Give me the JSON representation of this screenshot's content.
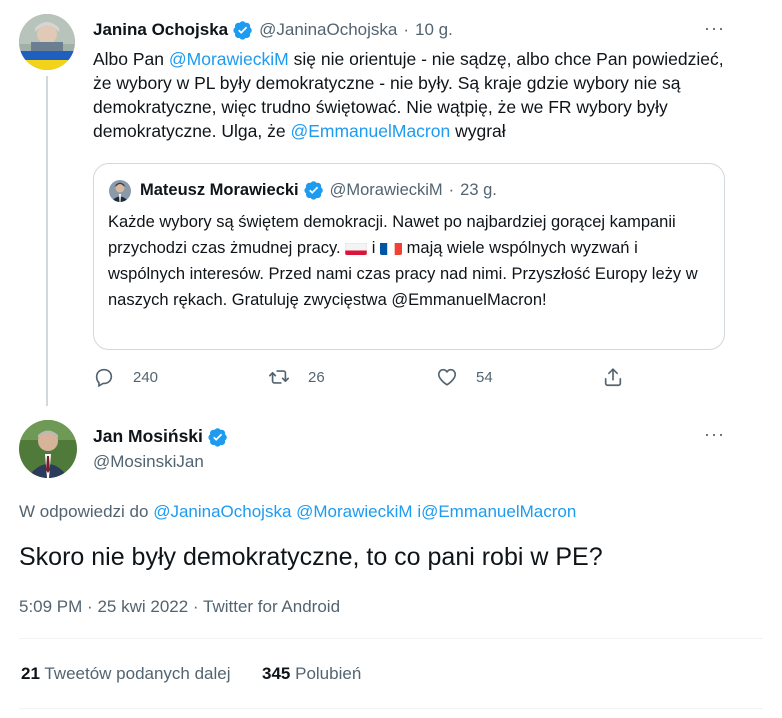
{
  "parent_tweet": {
    "author_name": "Janina Ochojska",
    "author_handle": "@JaninaOchojska",
    "time_separator": "·",
    "time": "10 g.",
    "text_parts": [
      "Albo Pan ",
      "@MorawieckiM",
      "  się nie orientuje - nie sądzę, albo chce Pan powiedzieć, że wybory w PL były demokratyczne - nie były. Są kraje gdzie wybory nie są demokratyczne, więc trudno świętować. Nie wątpię, że we FR wybory były demokratyczne. Ulga, że ",
      "@EmmanuelMacron",
      " wygrał"
    ],
    "more_label": "···",
    "actions": {
      "reply_count": "240",
      "retweet_count": "26",
      "like_count": "54"
    }
  },
  "quoted_tweet": {
    "author_name": "Mateusz Morawiecki",
    "author_handle": "@MorawieckiM",
    "time_separator": "·",
    "time": "23 g.",
    "text_before_flags": "Każde wybory są świętem demokracji. Nawet po najbardziej gorącej kampanii przychodzi czas żmudnej pracy. ",
    "flag_joiner": " i ",
    "text_after_flags": " mają wiele wspólnych wyzwań i wspólnych interesów. Przed nami czas pracy nad nimi. Przyszłość Europy leży w naszych rękach. Gratuluję zwycięstwa @EmmanuelMacron!"
  },
  "main_tweet": {
    "author_name": "Jan Mosiński",
    "author_handle": "@MosinskiJan",
    "more_label": "···",
    "reply_prefix": "W odpowiedzi do ",
    "reply_mentions": [
      "@JaninaOchojska",
      "@MorawieckiM",
      "i@EmmanuelMacron"
    ],
    "text": "Skoro nie były demokratyczne, to co pani robi w PE?",
    "time": "5:09 PM",
    "date": "25 kwi 2022",
    "source": "Twitter for Android",
    "meta_separator": "·",
    "retweets_count": "21",
    "retweets_label": "Tweetów podanych dalej",
    "likes_count": "345",
    "likes_label": "Polubień"
  },
  "colors": {
    "accent": "#1d9bf0",
    "text": "#0f1419",
    "muted": "#536471",
    "border": "#cfd9de"
  },
  "icons": [
    "verified-badge-icon",
    "more-icon",
    "reply-icon",
    "retweet-icon",
    "like-icon",
    "share-icon",
    "flag-poland-icon",
    "flag-france-icon"
  ]
}
